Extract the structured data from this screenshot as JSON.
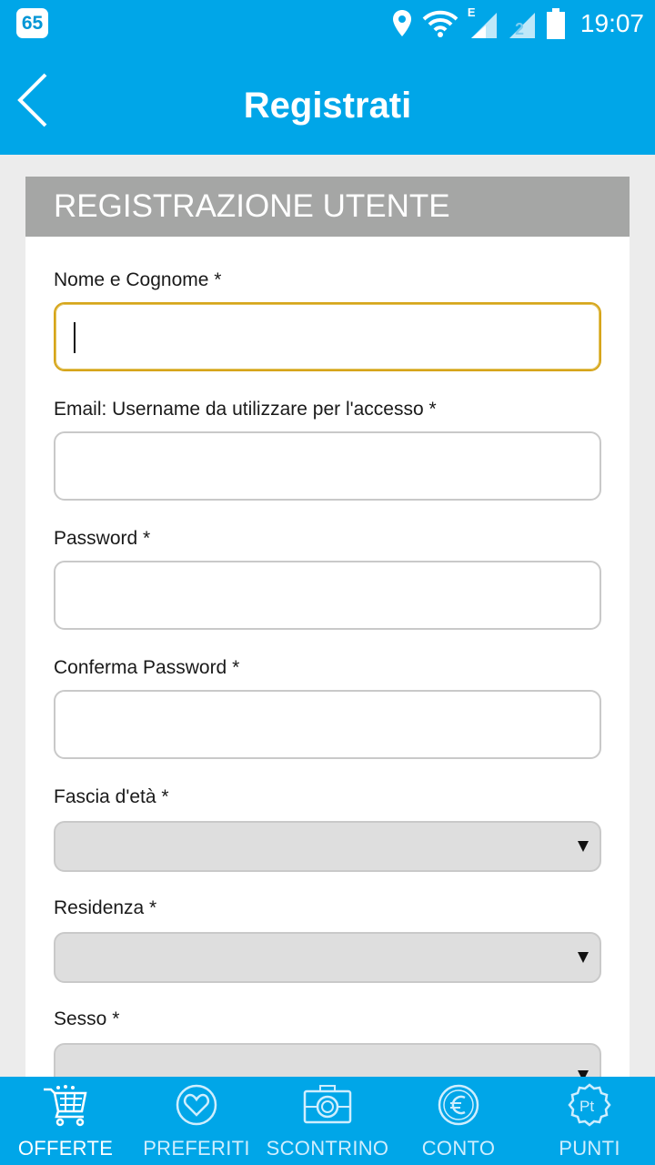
{
  "status_bar": {
    "badge": "65",
    "network_label": "E",
    "time": "19:07"
  },
  "header": {
    "title": "Registrati"
  },
  "form": {
    "section_title": "REGISTRAZIONE UTENTE",
    "fields": [
      {
        "label": "Nome e Cognome *",
        "value": ""
      },
      {
        "label": "Email: Username da utilizzare per l'accesso *",
        "value": ""
      },
      {
        "label": "Password *",
        "value": ""
      },
      {
        "label": "Conferma Password *",
        "value": ""
      },
      {
        "label": "Fascia d'età *",
        "value": ""
      },
      {
        "label": "Residenza *",
        "value": ""
      },
      {
        "label": "Sesso *",
        "value": ""
      }
    ]
  },
  "bottom_nav": {
    "items": [
      {
        "label": "OFFERTE",
        "icon": "cart-icon"
      },
      {
        "label": "PREFERITI",
        "icon": "heart-icon"
      },
      {
        "label": "SCONTRINO",
        "icon": "camera-icon"
      },
      {
        "label": "CONTO",
        "icon": "euro-icon"
      },
      {
        "label": "PUNTI",
        "icon": "points-badge-icon"
      }
    ]
  },
  "colors": {
    "primary": "#00a6e8",
    "section_header": "#a5a6a5",
    "focus_border": "#d6a51a"
  }
}
